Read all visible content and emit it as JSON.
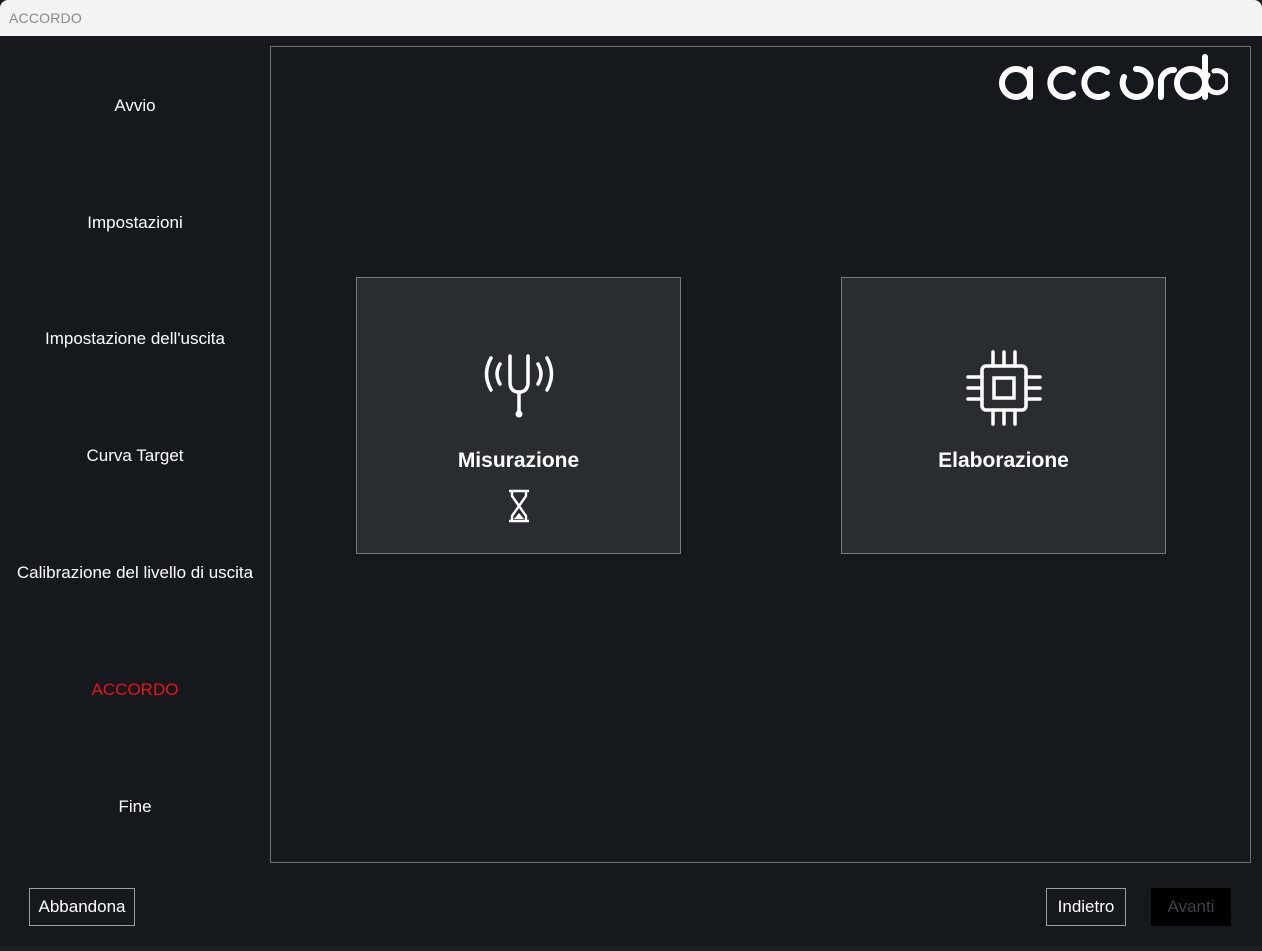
{
  "window": {
    "title": "ACCORDO"
  },
  "sidebar": {
    "items": [
      {
        "label": "Avvio"
      },
      {
        "label": "Impostazioni"
      },
      {
        "label": "Impostazione dell'uscita"
      },
      {
        "label": "Curva Target"
      },
      {
        "label": "Calibrazione del livello di uscita"
      },
      {
        "label": "ACCORDO",
        "active": true
      },
      {
        "label": "Fine"
      }
    ]
  },
  "brand": {
    "logo_text": "accordo",
    "active_color": "#e8141a",
    "background_color": "#15181c",
    "tile_color": "#292d31"
  },
  "main": {
    "tiles": [
      {
        "label": "Misurazione",
        "icon": "tuning-fork-icon",
        "status_icon": "hourglass-icon"
      },
      {
        "label": "Elaborazione",
        "icon": "cpu-chip-icon"
      }
    ]
  },
  "footer": {
    "abandon_label": "Abbandona",
    "back_label": "Indietro",
    "next_label": "Avanti",
    "next_enabled": false
  }
}
